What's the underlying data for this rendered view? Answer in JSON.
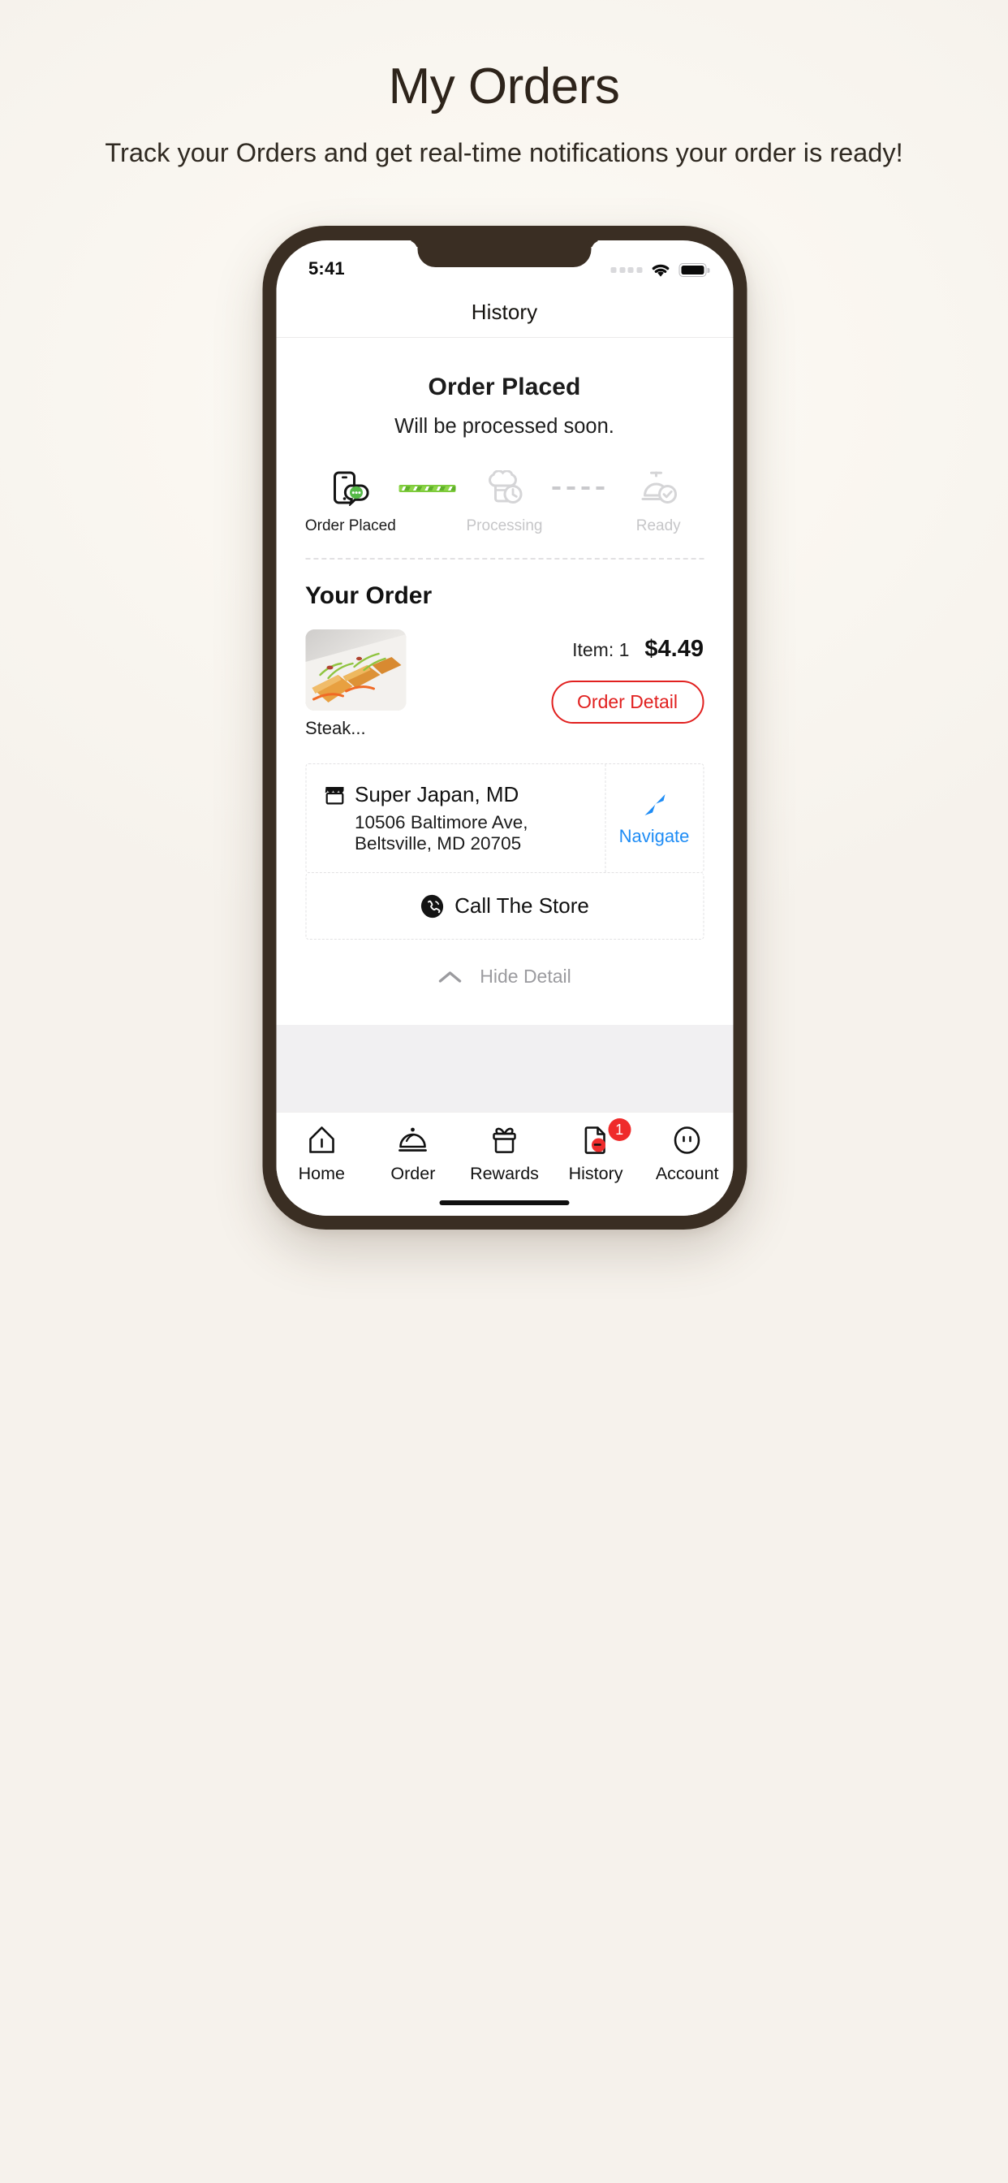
{
  "promo": {
    "title": "My Orders",
    "subtitle": "Track your Orders and get real-time notifications your order is ready!"
  },
  "status_bar": {
    "time": "5:41",
    "signal_icon": "signal-dots-icon",
    "wifi_icon": "wifi-icon",
    "battery_icon": "battery-icon"
  },
  "navbar": {
    "title": "History"
  },
  "order_status": {
    "title": "Order Placed",
    "subtitle": "Will be processed soon.",
    "steps": [
      {
        "label": "Order Placed",
        "icon": "phone-chat-icon",
        "state": "done"
      },
      {
        "label": "Processing",
        "icon": "chef-hat-clock-icon",
        "state": "todo"
      },
      {
        "label": "Ready",
        "icon": "bell-check-icon",
        "state": "todo"
      }
    ]
  },
  "your_order": {
    "heading": "Your Order",
    "item_name": "Steak...",
    "item_thumb_icon": "food-photo",
    "item_count_label": "Item: 1",
    "item_price": "$4.49",
    "detail_button": "Order Detail"
  },
  "store": {
    "store_icon": "storefront-icon",
    "name": "Super Japan, MD",
    "address": "10506 Baltimore Ave, Beltsville, MD 20705",
    "navigate_icon": "navigation-arrow-icon",
    "navigate_label": "Navigate",
    "call_icon": "phone-call-icon",
    "call_label": "Call The Store"
  },
  "hide_detail": {
    "icon": "chevron-up-icon",
    "label": "Hide Detail"
  },
  "tabbar": {
    "items": [
      {
        "label": "Home",
        "icon": "home-icon",
        "badge": ""
      },
      {
        "label": "Order",
        "icon": "cloche-icon",
        "badge": ""
      },
      {
        "label": "Rewards",
        "icon": "gift-icon",
        "badge": ""
      },
      {
        "label": "History",
        "icon": "document-icon",
        "badge": "1"
      },
      {
        "label": "Account",
        "icon": "face-icon",
        "badge": ""
      }
    ]
  },
  "colors": {
    "frame": "#3a2e23",
    "accent_red": "#e1201f",
    "accent_blue": "#1e8cf5",
    "progress_green": "#7ecb3c",
    "badge_red": "#ef2b2b",
    "page_bg": "#faf7f1"
  }
}
